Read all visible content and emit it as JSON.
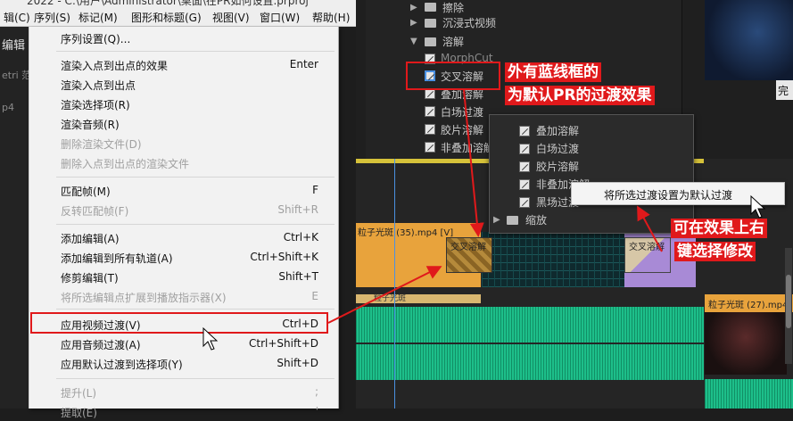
{
  "title_clip": "2022 - C:\\用户\\Administrator\\桌面\\在PR如何设置.prproj",
  "menubar": [
    {
      "label": "辑(C)"
    },
    {
      "label": "序列(S)"
    },
    {
      "label": "标记(M)"
    },
    {
      "label": "图形和标题(G)"
    },
    {
      "label": "视图(V)"
    },
    {
      "label": "窗口(W)"
    },
    {
      "label": "帮助(H)"
    }
  ],
  "left_panel": {
    "tab": "编辑",
    "t1": "etri 范",
    "t2": "p4"
  },
  "menu": {
    "items": [
      {
        "label": "序列设置(Q)...",
        "shortcut": "",
        "disabled": false
      },
      {
        "label": "渲染入点到出点的效果",
        "shortcut": "Enter",
        "disabled": false
      },
      {
        "label": "渲染入点到出点",
        "shortcut": "",
        "disabled": false
      },
      {
        "label": "渲染选择项(R)",
        "shortcut": "",
        "disabled": false
      },
      {
        "label": "渲染音频(R)",
        "shortcut": "",
        "disabled": false
      },
      {
        "label": "删除渲染文件(D)",
        "shortcut": "",
        "disabled": true
      },
      {
        "label": "删除入点到出点的渲染文件",
        "shortcut": "",
        "disabled": true
      },
      {
        "label": "匹配帧(M)",
        "shortcut": "F",
        "disabled": false
      },
      {
        "label": "反转匹配帧(F)",
        "shortcut": "Shift+R",
        "disabled": true
      },
      {
        "label": "添加编辑(A)",
        "shortcut": "Ctrl+K",
        "disabled": false
      },
      {
        "label": "添加编辑到所有轨道(A)",
        "shortcut": "Ctrl+Shift+K",
        "disabled": false
      },
      {
        "label": "修剪编辑(T)",
        "shortcut": "Shift+T",
        "disabled": false
      },
      {
        "label": "将所选编辑点扩展到播放指示器(X)",
        "shortcut": "E",
        "disabled": true
      },
      {
        "label": "应用视频过渡(V)",
        "shortcut": "Ctrl+D",
        "disabled": false
      },
      {
        "label": "应用音频过渡(A)",
        "shortcut": "Ctrl+Shift+D",
        "disabled": false
      },
      {
        "label": "应用默认过渡到选择项(Y)",
        "shortcut": "Shift+D",
        "disabled": false
      },
      {
        "label": "提升(L)",
        "shortcut": ";",
        "disabled": true
      },
      {
        "label": "提取(E)",
        "shortcut": "'",
        "disabled": true
      }
    ]
  },
  "effects_tree": {
    "items": [
      {
        "label": "擦除",
        "kind": "folder"
      },
      {
        "label": "沉浸式视频",
        "kind": "folder"
      },
      {
        "label": "溶解",
        "kind": "folder-open"
      },
      {
        "label": "MorphCut",
        "kind": "effect"
      },
      {
        "label": "交叉溶解",
        "kind": "effect"
      },
      {
        "label": "叠加溶解",
        "kind": "effect"
      },
      {
        "label": "白场过渡",
        "kind": "effect"
      },
      {
        "label": "胶片溶解",
        "kind": "effect"
      },
      {
        "label": "非叠加溶解",
        "kind": "effect"
      }
    ]
  },
  "popup_list": {
    "items": [
      {
        "label": "叠加溶解"
      },
      {
        "label": "白场过渡"
      },
      {
        "label": "胶片溶解"
      },
      {
        "label": "非叠加溶解"
      },
      {
        "label": "黑场过渡"
      },
      {
        "label": "缩放"
      }
    ]
  },
  "context_menu": {
    "item": "将所选过渡设置为默认过渡"
  },
  "done_button": "完",
  "timeline": {
    "clip1_name": "粒子光斑 (35).mp4 [V]",
    "transition1": "交叉溶解",
    "transition2": "交叉溶解",
    "track2_label": "粒子光斑",
    "right_clip": "粒子光斑 (27).mp4"
  },
  "annotations": {
    "a1_line1": "外有蓝线框的",
    "a1_line2": "为默认PR的过渡效果",
    "a2_line1": "可在效果上右",
    "a2_line2": "键选择修改"
  },
  "colors": {
    "highlight_red": "#e0191b",
    "menu_bg": "#f2f2f2",
    "selection_blue": "#cce1f5"
  }
}
